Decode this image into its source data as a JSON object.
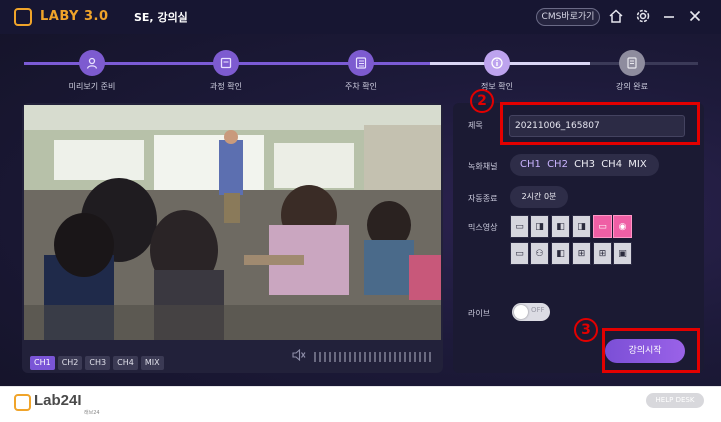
{
  "app": {
    "logo_text": "LABY 3.0",
    "room": "SE, 강의실"
  },
  "titlebar": {
    "cms_label": "CMS바로가기",
    "home_icon": "home-icon",
    "settings_icon": "gear-icon",
    "minimize_icon": "minimize-icon",
    "close_icon": "close-icon"
  },
  "steps": [
    {
      "label": "미리보기 준비",
      "icon": "user-icon",
      "state": "done"
    },
    {
      "label": "과정 확인",
      "icon": "slides-icon",
      "state": "done"
    },
    {
      "label": "주차 확인",
      "icon": "list-icon",
      "state": "done"
    },
    {
      "label": "정보 확인",
      "icon": "info-icon",
      "state": "active"
    },
    {
      "label": "강의 완료",
      "icon": "document-icon",
      "state": "pending"
    }
  ],
  "preview": {
    "channels": [
      "CH1",
      "CH2",
      "CH3",
      "CH4",
      "MIX"
    ],
    "active_channel": "CH1",
    "speaker_icon": "speaker-icon"
  },
  "settings": {
    "title_label": "제목",
    "title_value": "20211006_165807",
    "rec_channel_label": "녹화채널",
    "rec_channels": [
      {
        "label": "CH1",
        "selected": true
      },
      {
        "label": "CH2",
        "selected": true
      },
      {
        "label": "CH3",
        "selected": false
      },
      {
        "label": "CH4",
        "selected": false
      },
      {
        "label": "MIX",
        "selected": false
      }
    ],
    "auto_end_label": "자동종료",
    "auto_end_value": "2시간 0분",
    "mix_label": "믹스영상",
    "live_label": "라이브",
    "live_toggle": "OFF",
    "start_label": "강의시작"
  },
  "annotations": {
    "marker_2": "2",
    "marker_3": "3",
    "color": "#e30000"
  },
  "footer": {
    "logo_text": "Lab24I",
    "logo_sub": "래브24",
    "help_label": "HELP DESK"
  },
  "colors": {
    "accent": "#7b55d6",
    "brand": "#f0a42a",
    "mix_selected": "#ef5fa5"
  }
}
